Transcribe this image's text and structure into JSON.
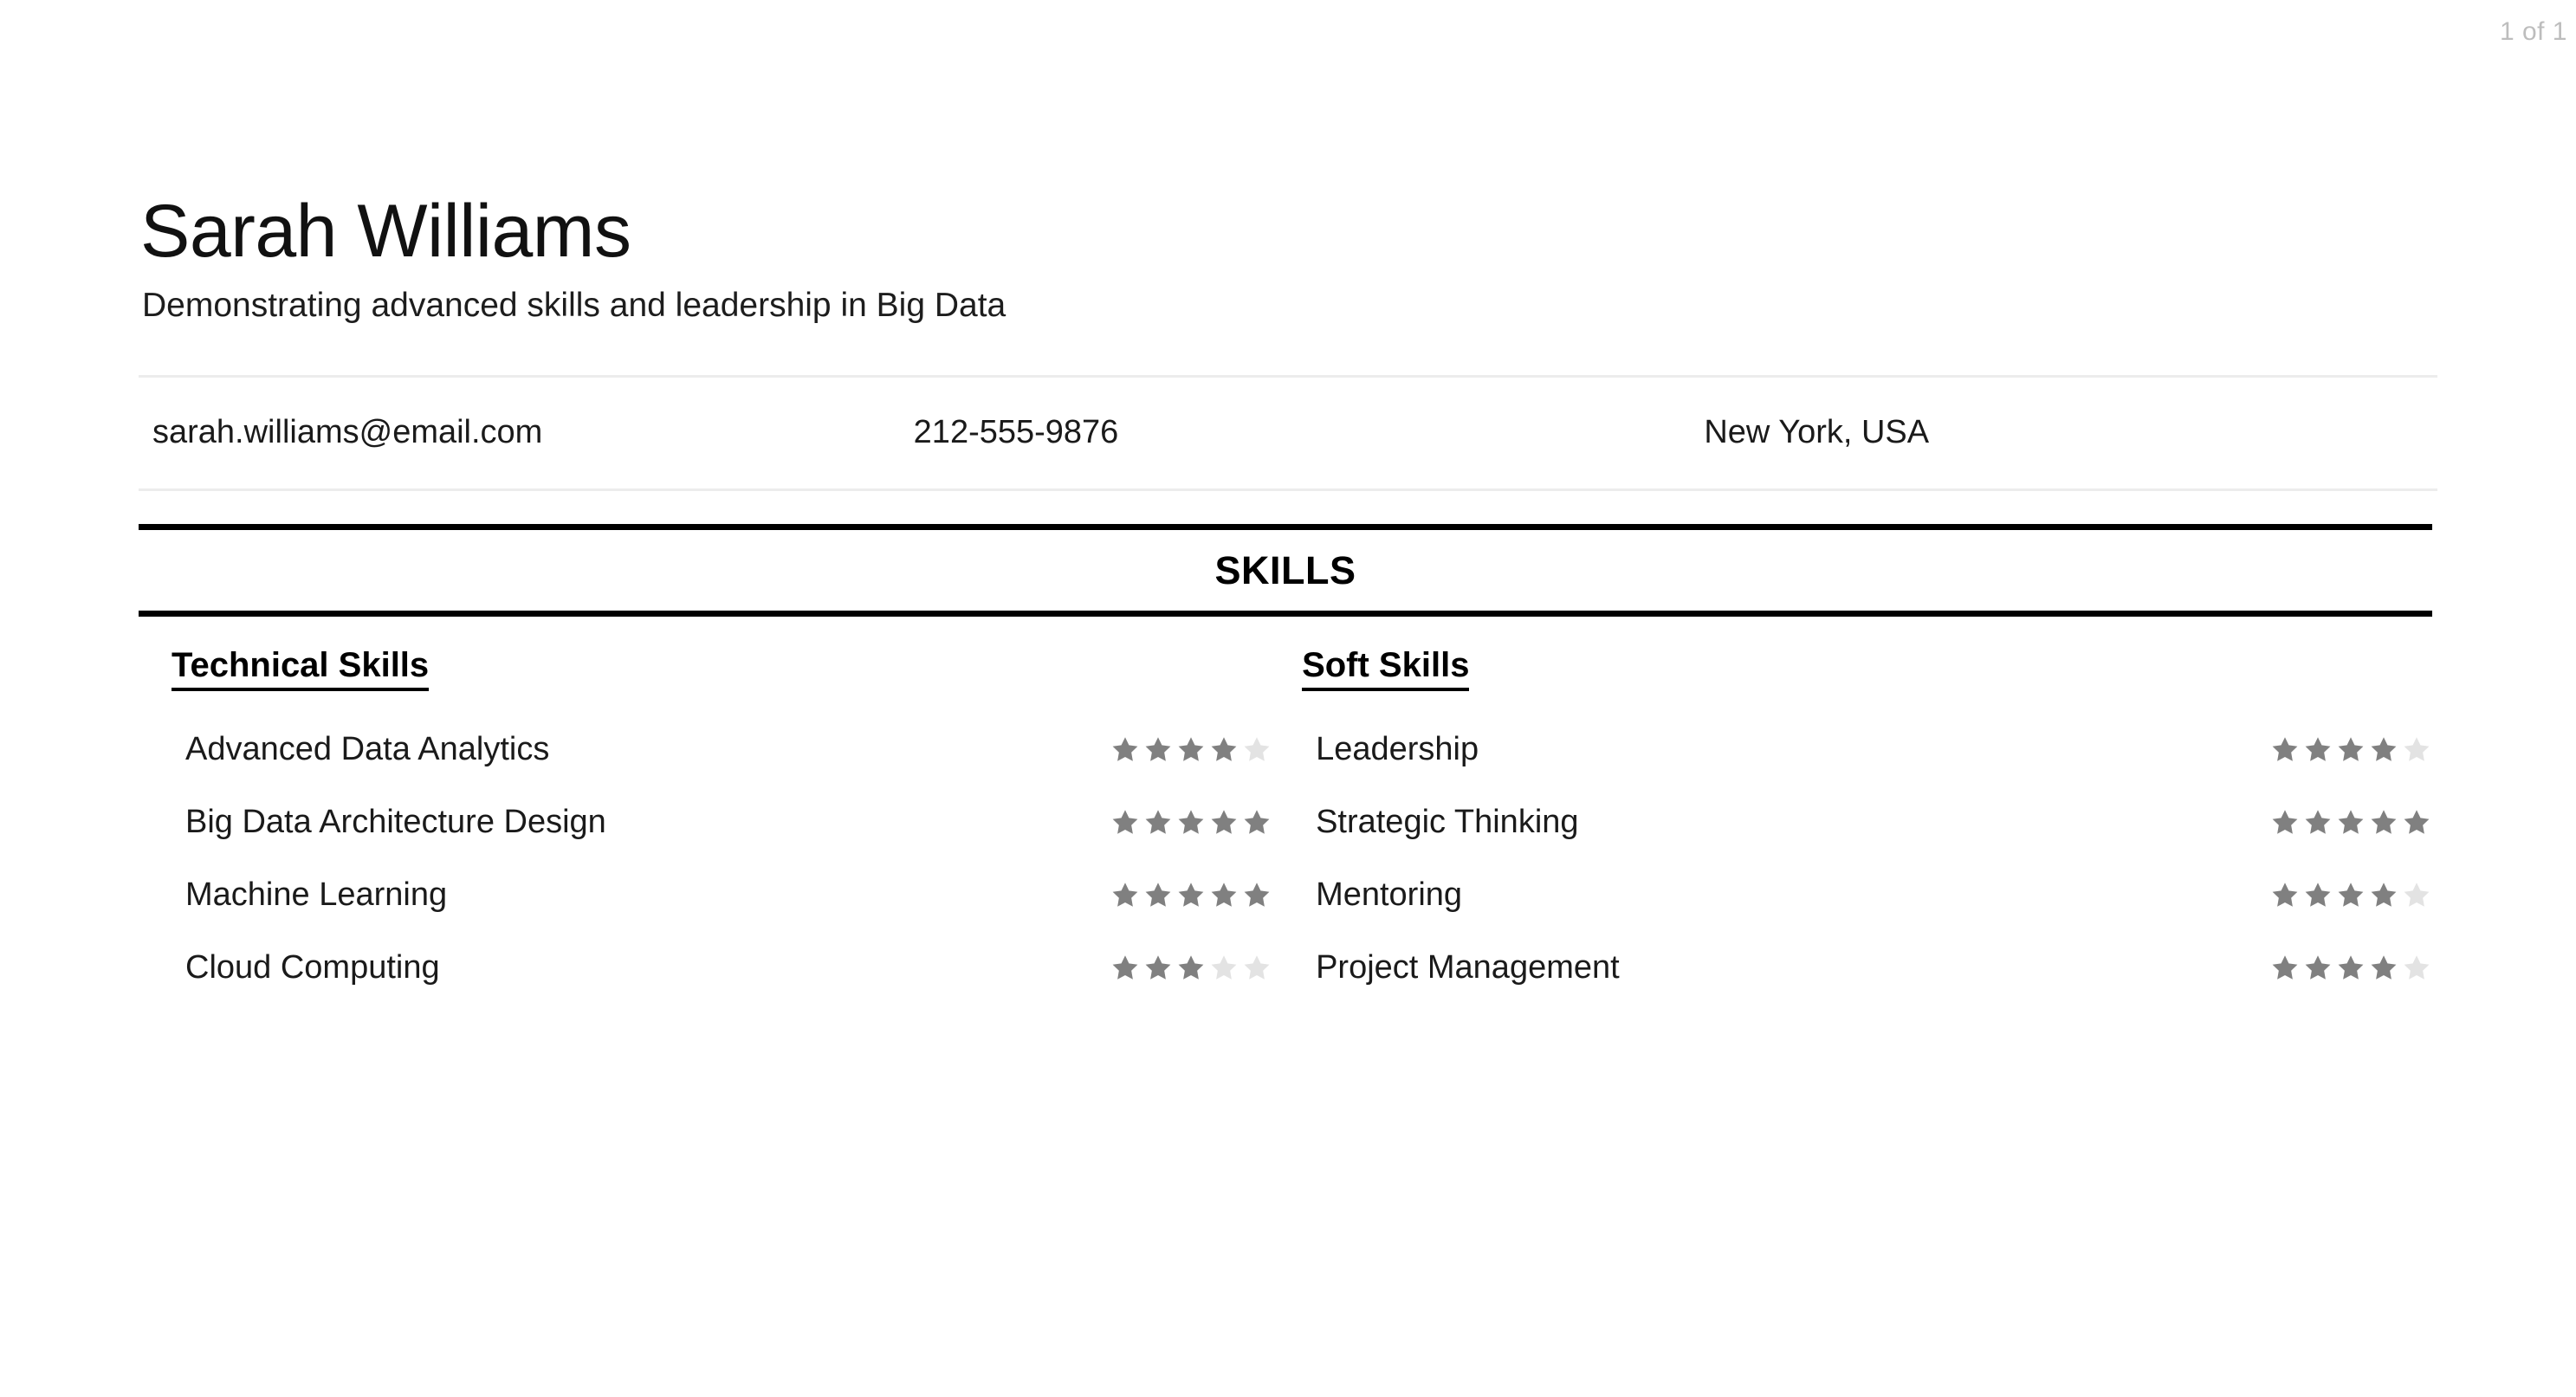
{
  "page": {
    "indicator": "1 of 1"
  },
  "header": {
    "name": "Sarah Williams",
    "tagline": "Demonstrating advanced skills and leadership in Big Data"
  },
  "contact": {
    "email": "sarah.williams@email.com",
    "phone": "212-555-9876",
    "location": "New York, USA"
  },
  "skills_section": {
    "title": "SKILLS",
    "columns": [
      {
        "heading": "Technical Skills",
        "items": [
          {
            "label": "Advanced Data Analytics",
            "rating": 4,
            "max": 5
          },
          {
            "label": "Big Data Architecture Design",
            "rating": 5,
            "max": 5
          },
          {
            "label": "Machine Learning",
            "rating": 5,
            "max": 5
          },
          {
            "label": "Cloud Computing",
            "rating": 3,
            "max": 5
          }
        ]
      },
      {
        "heading": "Soft Skills",
        "items": [
          {
            "label": "Leadership",
            "rating": 4,
            "max": 5
          },
          {
            "label": "Strategic Thinking",
            "rating": 5,
            "max": 5
          },
          {
            "label": "Mentoring",
            "rating": 4,
            "max": 5
          },
          {
            "label": "Project Management",
            "rating": 4,
            "max": 5
          }
        ]
      }
    ]
  },
  "colors": {
    "star_filled": "#808080",
    "star_empty": "#e3e3e3",
    "rule_dark": "#000000",
    "rule_light": "#ececec",
    "page_indicator": "#bdbdbd"
  }
}
